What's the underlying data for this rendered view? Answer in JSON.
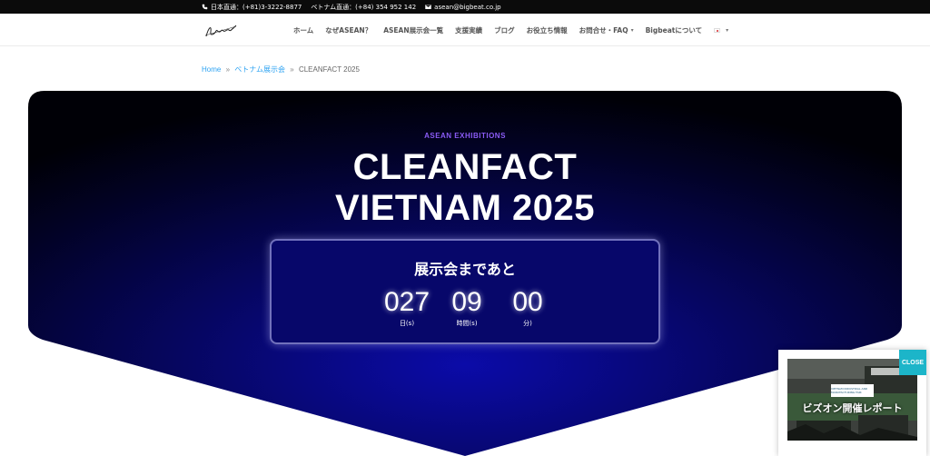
{
  "topbar": {
    "phone_japan": "日本直通：(+81)3-3222-8877",
    "phone_vietnam": "ベトナム直通：(+84) 354 952 142",
    "email": "asean@bigbeat.co.jp"
  },
  "logo": {
    "text": "Bigbeat"
  },
  "nav": {
    "items": [
      {
        "label": "ホーム"
      },
      {
        "label": "なぜASEAN？"
      },
      {
        "label": "ASEAN展示会一覧"
      },
      {
        "label": "支援実績"
      },
      {
        "label": "ブログ"
      },
      {
        "label": "お役立ち情報"
      },
      {
        "label": "お問合せ・FAQ"
      },
      {
        "label": "Bigbeatについて"
      }
    ]
  },
  "breadcrumb": {
    "home": "Home",
    "sep": "»",
    "parent": "ベトナム展示会",
    "current": "CLEANFACT 2025"
  },
  "hero": {
    "eyebrow": "ASEAN EXHIBITIONS",
    "title_line1": "CLEANFACT",
    "title_line2": "VIETNAM 2025"
  },
  "countdown": {
    "title": "展示会まであと",
    "days": "027",
    "days_label": "日(s)",
    "hours": "09",
    "hours_label": "時間(s)",
    "minutes": "00",
    "minutes_label": "分)"
  },
  "popup": {
    "close_label": "CLOSE",
    "image_caption": "ビズオン開催レポート",
    "logo_text": "VIETNAM INDUSTRIAL AND MANUFACTURING FAIR"
  },
  "colors": {
    "accent_purple": "#8b5cf6",
    "link_blue": "#2ea3f2",
    "close_teal": "#1cb5c9",
    "hero_navy": "#07076a"
  }
}
